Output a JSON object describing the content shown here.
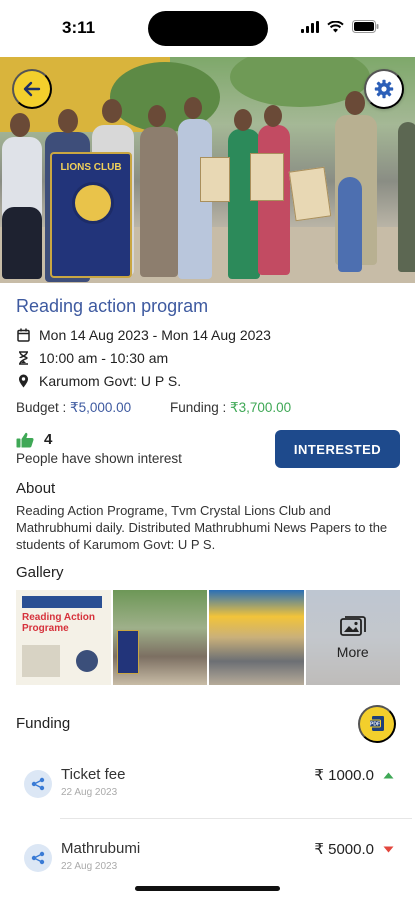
{
  "status": {
    "time": "3:11"
  },
  "hero": {
    "banner_text": "LIONS CLUB"
  },
  "event": {
    "title": "Reading action program",
    "dates": "Mon 14 Aug 2023 - Mon 14 Aug 2023",
    "time": "10:00 am - 10:30 am",
    "location": "Karumom Govt: U P S.",
    "budget_label": "Budget : ",
    "budget_value": "₹5,000.00",
    "funding_label": "Funding : ",
    "funding_value": "₹3,700.00",
    "likes_count": "4",
    "interest_text": "People have shown interest",
    "interested_button": "INTERESTED"
  },
  "about": {
    "heading": "About",
    "text": "Reading Action  Programe,  Tvm Crystal  Lions  Club and Mathrubhumi daily. Distributed  Mathrubhumi News  Papers to the students  of Karumom Govt: U P S."
  },
  "gallery": {
    "heading": "Gallery",
    "more_label": "More",
    "tile1_text": "Reading Action Programe"
  },
  "funding": {
    "heading": "Funding",
    "items": [
      {
        "name": "Ticket fee",
        "date": "22 Aug 2023",
        "amount": "₹ 1000.0",
        "trend": "up"
      },
      {
        "name": "Mathrubumi",
        "date": "22 Aug 2023",
        "amount": "₹ 5000.0",
        "trend": "down"
      }
    ]
  },
  "colors": {
    "accent": "#3e5aa0",
    "button": "#1e4a8c",
    "yellow": "#f3cf2c",
    "green": "#3fa856",
    "red": "#e2463d"
  }
}
